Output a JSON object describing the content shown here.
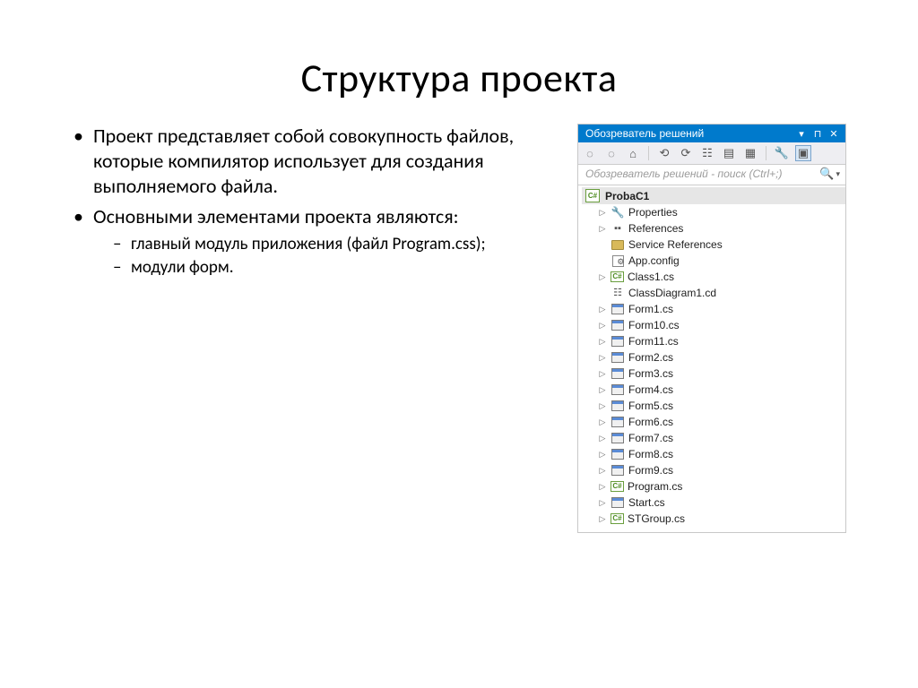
{
  "title": "Структура проекта",
  "bullets": {
    "b1": "Проект представляет собой совокупность файлов, которые компилятор использует для создания выполняемого файла.",
    "b2": "Основными элементами проекта являются:",
    "sub1": "главный модуль приложения (файл Program.css);",
    "sub2": " модули форм."
  },
  "panel": {
    "title": "Обозреватель решений",
    "search_placeholder": "Обозреватель решений - поиск (Ctrl+;)",
    "project": "ProbaC1",
    "items": {
      "properties": "Properties",
      "references": "References",
      "service_refs": "Service References",
      "app_config": "App.config",
      "class1": "Class1.cs",
      "classdiag": "ClassDiagram1.cd",
      "form1": "Form1.cs",
      "form10": "Form10.cs",
      "form11": "Form11.cs",
      "form2": "Form2.cs",
      "form3": "Form3.cs",
      "form4": "Form4.cs",
      "form5": "Form5.cs",
      "form6": "Form6.cs",
      "form7": "Form7.cs",
      "form8": "Form8.cs",
      "form9": "Form9.cs",
      "program": "Program.cs",
      "start": "Start.cs",
      "stgroup": "STGroup.cs"
    }
  }
}
